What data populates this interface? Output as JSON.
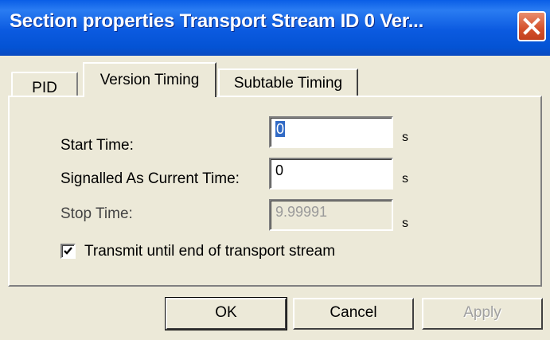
{
  "window": {
    "title": "Section properties Transport Stream ID    0 Ver..."
  },
  "tabs": [
    {
      "label": "PID"
    },
    {
      "label": "Version Timing"
    },
    {
      "label": "Subtable Timing"
    }
  ],
  "form": {
    "start_time": {
      "label": "Start Time:",
      "value": "0",
      "unit": "s"
    },
    "signalled_time": {
      "label": "Signalled As Current Time:",
      "value": "0",
      "unit": "s"
    },
    "stop_time": {
      "label": "Stop Time:",
      "value": "9.99991",
      "unit": "s"
    },
    "transmit_checkbox": {
      "label": "Transmit until end of transport stream",
      "checked": true
    }
  },
  "buttons": {
    "ok": "OK",
    "cancel": "Cancel",
    "apply": "Apply"
  }
}
